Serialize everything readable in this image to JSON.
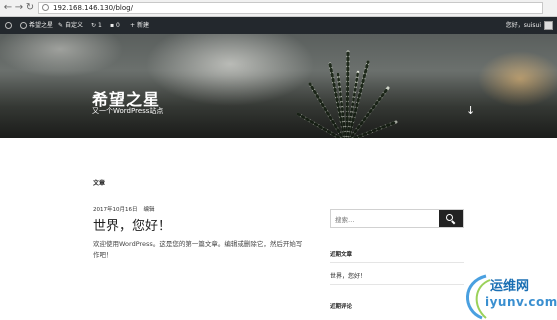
{
  "browser": {
    "url": "192.168.146.130/blog/",
    "back_icon": "back-arrow-icon",
    "forward_icon": "forward-arrow-icon",
    "reload_icon": "reload-icon"
  },
  "adminbar": {
    "site_name": "希望之星",
    "customize": "自定义",
    "updates_count": "1",
    "comments_count": "0",
    "new": "新建",
    "user_greeting": "您好，suisui"
  },
  "header": {
    "site_title": "希望之星",
    "tagline": "又一个WordPress站点",
    "scroll_glyph": "↓"
  },
  "main": {
    "section_label": "文章",
    "post": {
      "date": "2017年10月16日",
      "edit": "编辑",
      "title": "世界，您好！",
      "excerpt": "欢迎使用WordPress。这是您的第一篇文章。编辑或删除它，然后开始写作吧！"
    }
  },
  "sidebar": {
    "search_placeholder": "搜索…",
    "recent_posts_title": "近期文章",
    "recent_post_1": "世界，您好！",
    "recent_comments_title": "近期评论"
  },
  "watermark": {
    "text_cn": "运维网",
    "text_url": "iyunv.com"
  },
  "colors": {
    "adminbar_bg": "#23282d",
    "search_button": "#222222",
    "watermark": "#1a6fb3"
  }
}
